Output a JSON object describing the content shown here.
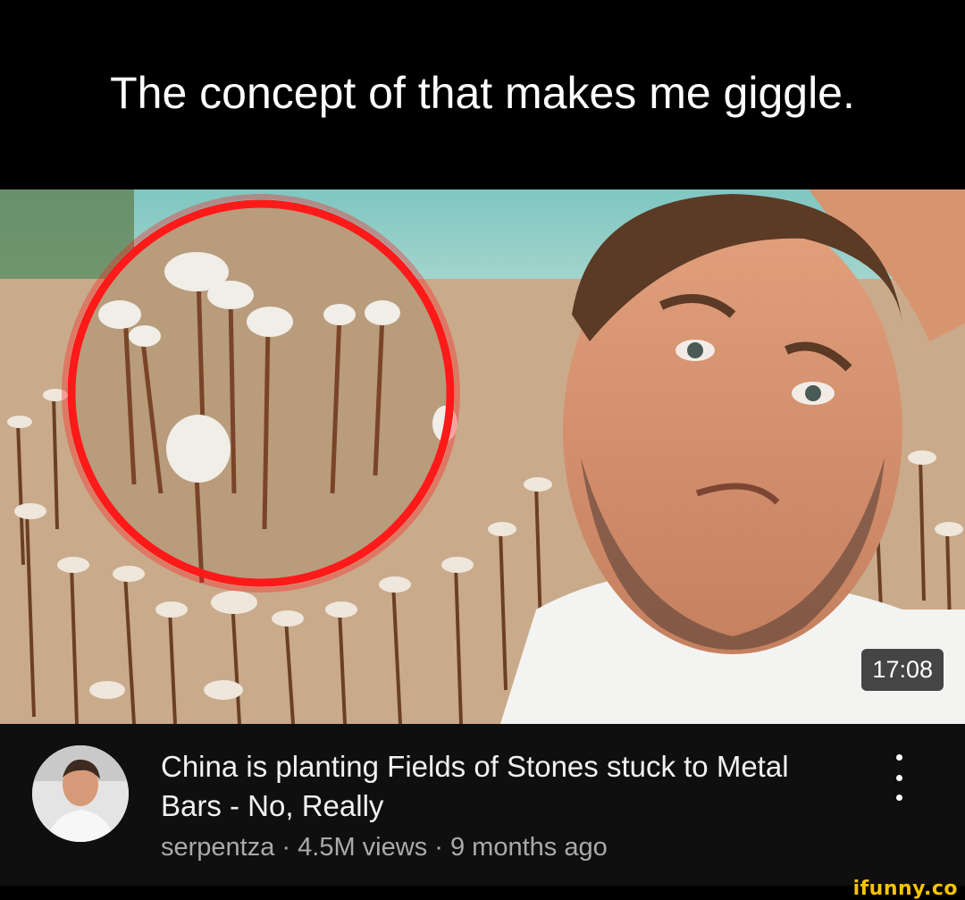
{
  "caption": {
    "text": "The concept of that makes me giggle."
  },
  "video": {
    "duration": "17:08",
    "title": "China is planting Fields of Stones stuck to Metal Bars - No, Really",
    "channel": "serpentza",
    "views": "4.5M views",
    "age": "9 months ago",
    "separator": "·",
    "more_icon": "more-vert-icon"
  },
  "watermark": {
    "text": "ifunny.co"
  },
  "colors": {
    "highlight_ring": "#ff1a1a",
    "watermark": "#f5c400",
    "meta_text": "#aaaaaa"
  }
}
